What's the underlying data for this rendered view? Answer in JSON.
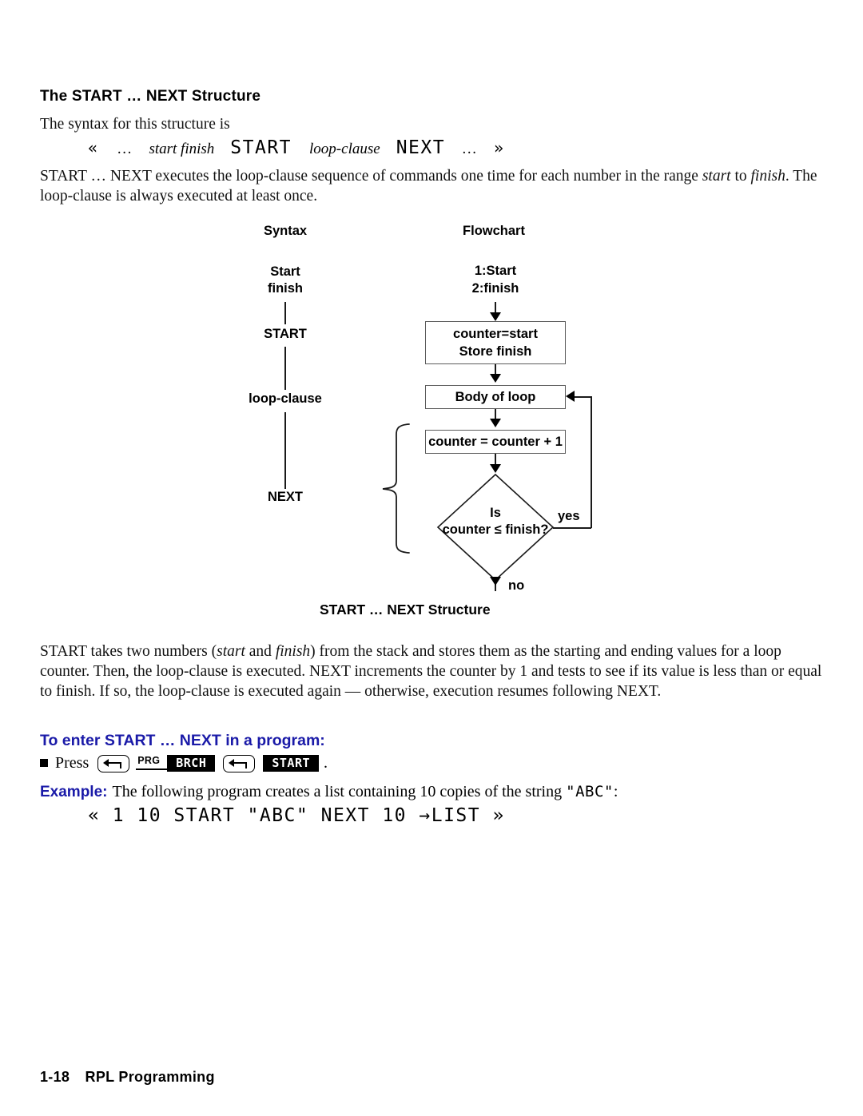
{
  "document": {
    "section_heading": "The START … NEXT Structure",
    "intro_line": "The syntax for this structure is",
    "syntax": {
      "open_guillemet": "«",
      "ellipsis_1": "…",
      "start_finish": "start finish",
      "start_kw": "START",
      "loop_clause": "loop-clause",
      "next_kw": "NEXT",
      "ellipsis_2": "…",
      "close_guillemet": "»"
    },
    "paragraph_1": "START … NEXT executes the loop-clause sequence of commands one time for each number in the range start to finish. The loop-clause is always executed at least once.",
    "paragraph_1_parts": {
      "a": "START … NEXT executes the loop-clause sequence of commands one time for each number in the range ",
      "italic_1": "start",
      "b": " to ",
      "italic_2": "finish",
      "c": ". The loop-clause is always executed at least once."
    },
    "paragraph_2_parts": {
      "a": "START takes two numbers (",
      "italic_1": "start",
      "b": " and ",
      "italic_2": "finish",
      "c": ") from the stack and stores them as the starting and ending values for a loop counter. Then, the loop-clause is executed. NEXT increments the counter by 1 and tests to see if its value is less than or equal to finish. If so, the loop-clause is executed again — otherwise, execution resumes following NEXT."
    },
    "to_enter_heading": "To enter START … NEXT in a program:",
    "press": {
      "bullet": "■",
      "word": "Press",
      "key_1_icon": "left-shift-arrow-key",
      "key_2_label": "PRG",
      "menu_key_1": "BRCH",
      "key_3_icon": "left-shift-arrow-key",
      "menu_key_2": "START",
      "trailing_period": "."
    },
    "example": {
      "label": "Example:",
      "text_a": "The following program creates a list containing 10 copies of the string ",
      "code_inline": "\"ABC\"",
      "text_b": ":",
      "code_line": "« 1 10 START \"ABC\" NEXT 10 →LIST »"
    },
    "footer": {
      "page_number": "1-18",
      "chapter_title": "RPL Programming"
    }
  },
  "figure": {
    "caption": "START … NEXT Structure",
    "column_headers": {
      "syntax": "Syntax",
      "flowchart": "Flowchart"
    },
    "syntax_column": [
      {
        "label": "Start"
      },
      {
        "label": "finish"
      },
      {
        "label": "START"
      },
      {
        "label": "loop-clause"
      },
      {
        "label": "NEXT"
      }
    ],
    "flowchart": {
      "stack_labels": [
        "1:Start",
        "2:finish"
      ],
      "nodes": [
        {
          "id": "init",
          "type": "process",
          "lines": [
            "counter=start",
            "Store finish"
          ]
        },
        {
          "id": "body",
          "type": "process",
          "lines": [
            "Body of loop"
          ]
        },
        {
          "id": "increment",
          "type": "process",
          "lines": [
            "counter = counter + 1"
          ]
        },
        {
          "id": "test",
          "type": "decision",
          "lines": [
            "Is",
            "counter ≤ finish?"
          ]
        }
      ],
      "edge_labels": {
        "yes": "yes",
        "no": "no"
      },
      "brace_symbol": "{"
    }
  }
}
